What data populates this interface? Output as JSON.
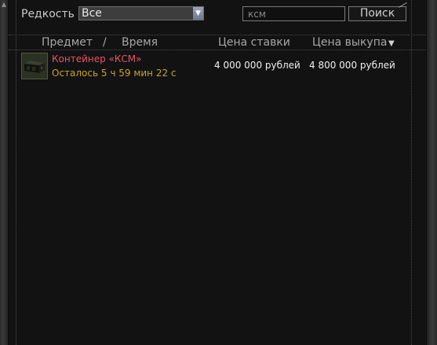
{
  "filters": {
    "rarity_label": "Редкость",
    "rarity_selected": "Все",
    "search_value": "ксм",
    "search_button_label": "Поиск"
  },
  "columns": {
    "item": "Предмет",
    "separator": "/",
    "time": "Время",
    "bid": "Цена ставки",
    "buyout": "Цена выкупа",
    "sort_indicator": "▼"
  },
  "lots": [
    {
      "name": "Контейнер «КСМ»",
      "time_left": "Осталось 5 ч 59 мин 22 с",
      "bid_price": "4 000 000 рублей",
      "buyout_price": "4 800 000 рублей",
      "icon": "container-icon"
    }
  ],
  "colors": {
    "item_name": "#e5546a",
    "time_left": "#c6a427",
    "price": "#f0f0f0",
    "header_text": "#a7a7a7",
    "panel_bg": "#121212"
  }
}
